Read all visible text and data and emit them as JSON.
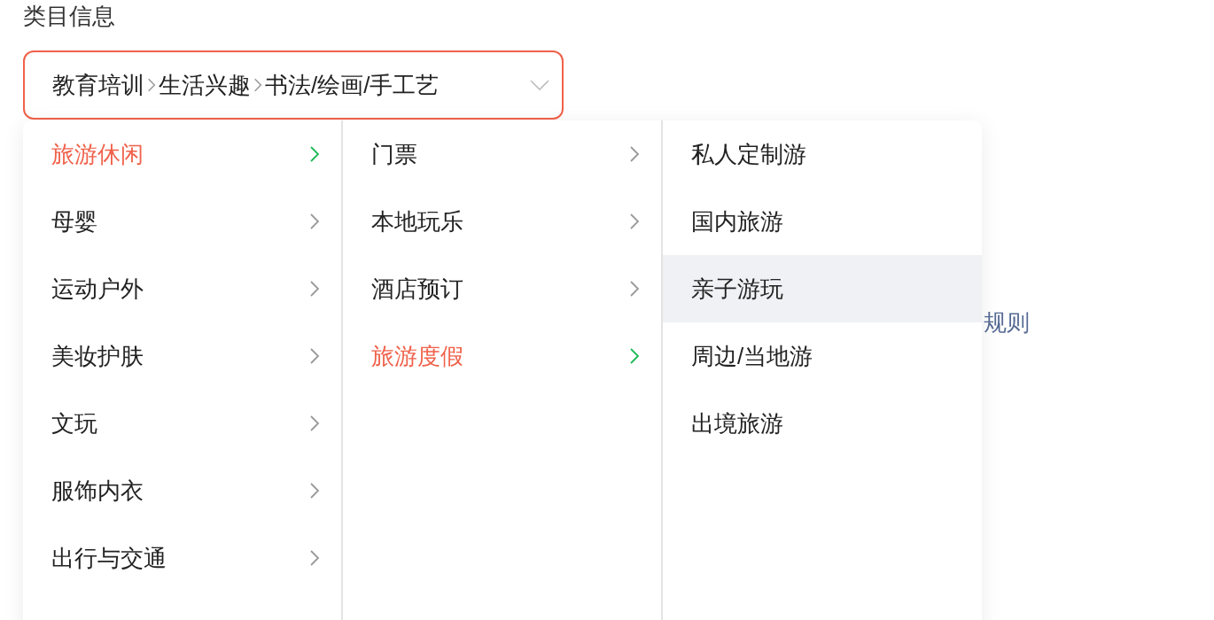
{
  "field_label": "类目信息",
  "select": {
    "path": [
      "教育培训",
      "生活兴趣",
      "书法/绘画/手工艺"
    ],
    "expanded": true
  },
  "background_link": "规则",
  "columns": [
    {
      "items": [
        {
          "label": "旅游休闲",
          "selected": true,
          "has_children": true
        },
        {
          "label": "母婴",
          "selected": false,
          "has_children": true
        },
        {
          "label": "运动户外",
          "selected": false,
          "has_children": true
        },
        {
          "label": "美妆护肤",
          "selected": false,
          "has_children": true
        },
        {
          "label": "文玩",
          "selected": false,
          "has_children": true
        },
        {
          "label": "服饰内衣",
          "selected": false,
          "has_children": true
        },
        {
          "label": "出行与交通",
          "selected": false,
          "has_children": true
        }
      ]
    },
    {
      "items": [
        {
          "label": "门票",
          "selected": false,
          "has_children": true
        },
        {
          "label": "本地玩乐",
          "selected": false,
          "has_children": true
        },
        {
          "label": "酒店预订",
          "selected": false,
          "has_children": true
        },
        {
          "label": "旅游度假",
          "selected": true,
          "has_children": true
        }
      ]
    },
    {
      "items": [
        {
          "label": "私人定制游",
          "selected": false
        },
        {
          "label": "国内旅游",
          "selected": false
        },
        {
          "label": "亲子游玩",
          "selected": true
        },
        {
          "label": "周边/当地游",
          "selected": false
        },
        {
          "label": "出境旅游",
          "selected": false
        }
      ]
    }
  ]
}
